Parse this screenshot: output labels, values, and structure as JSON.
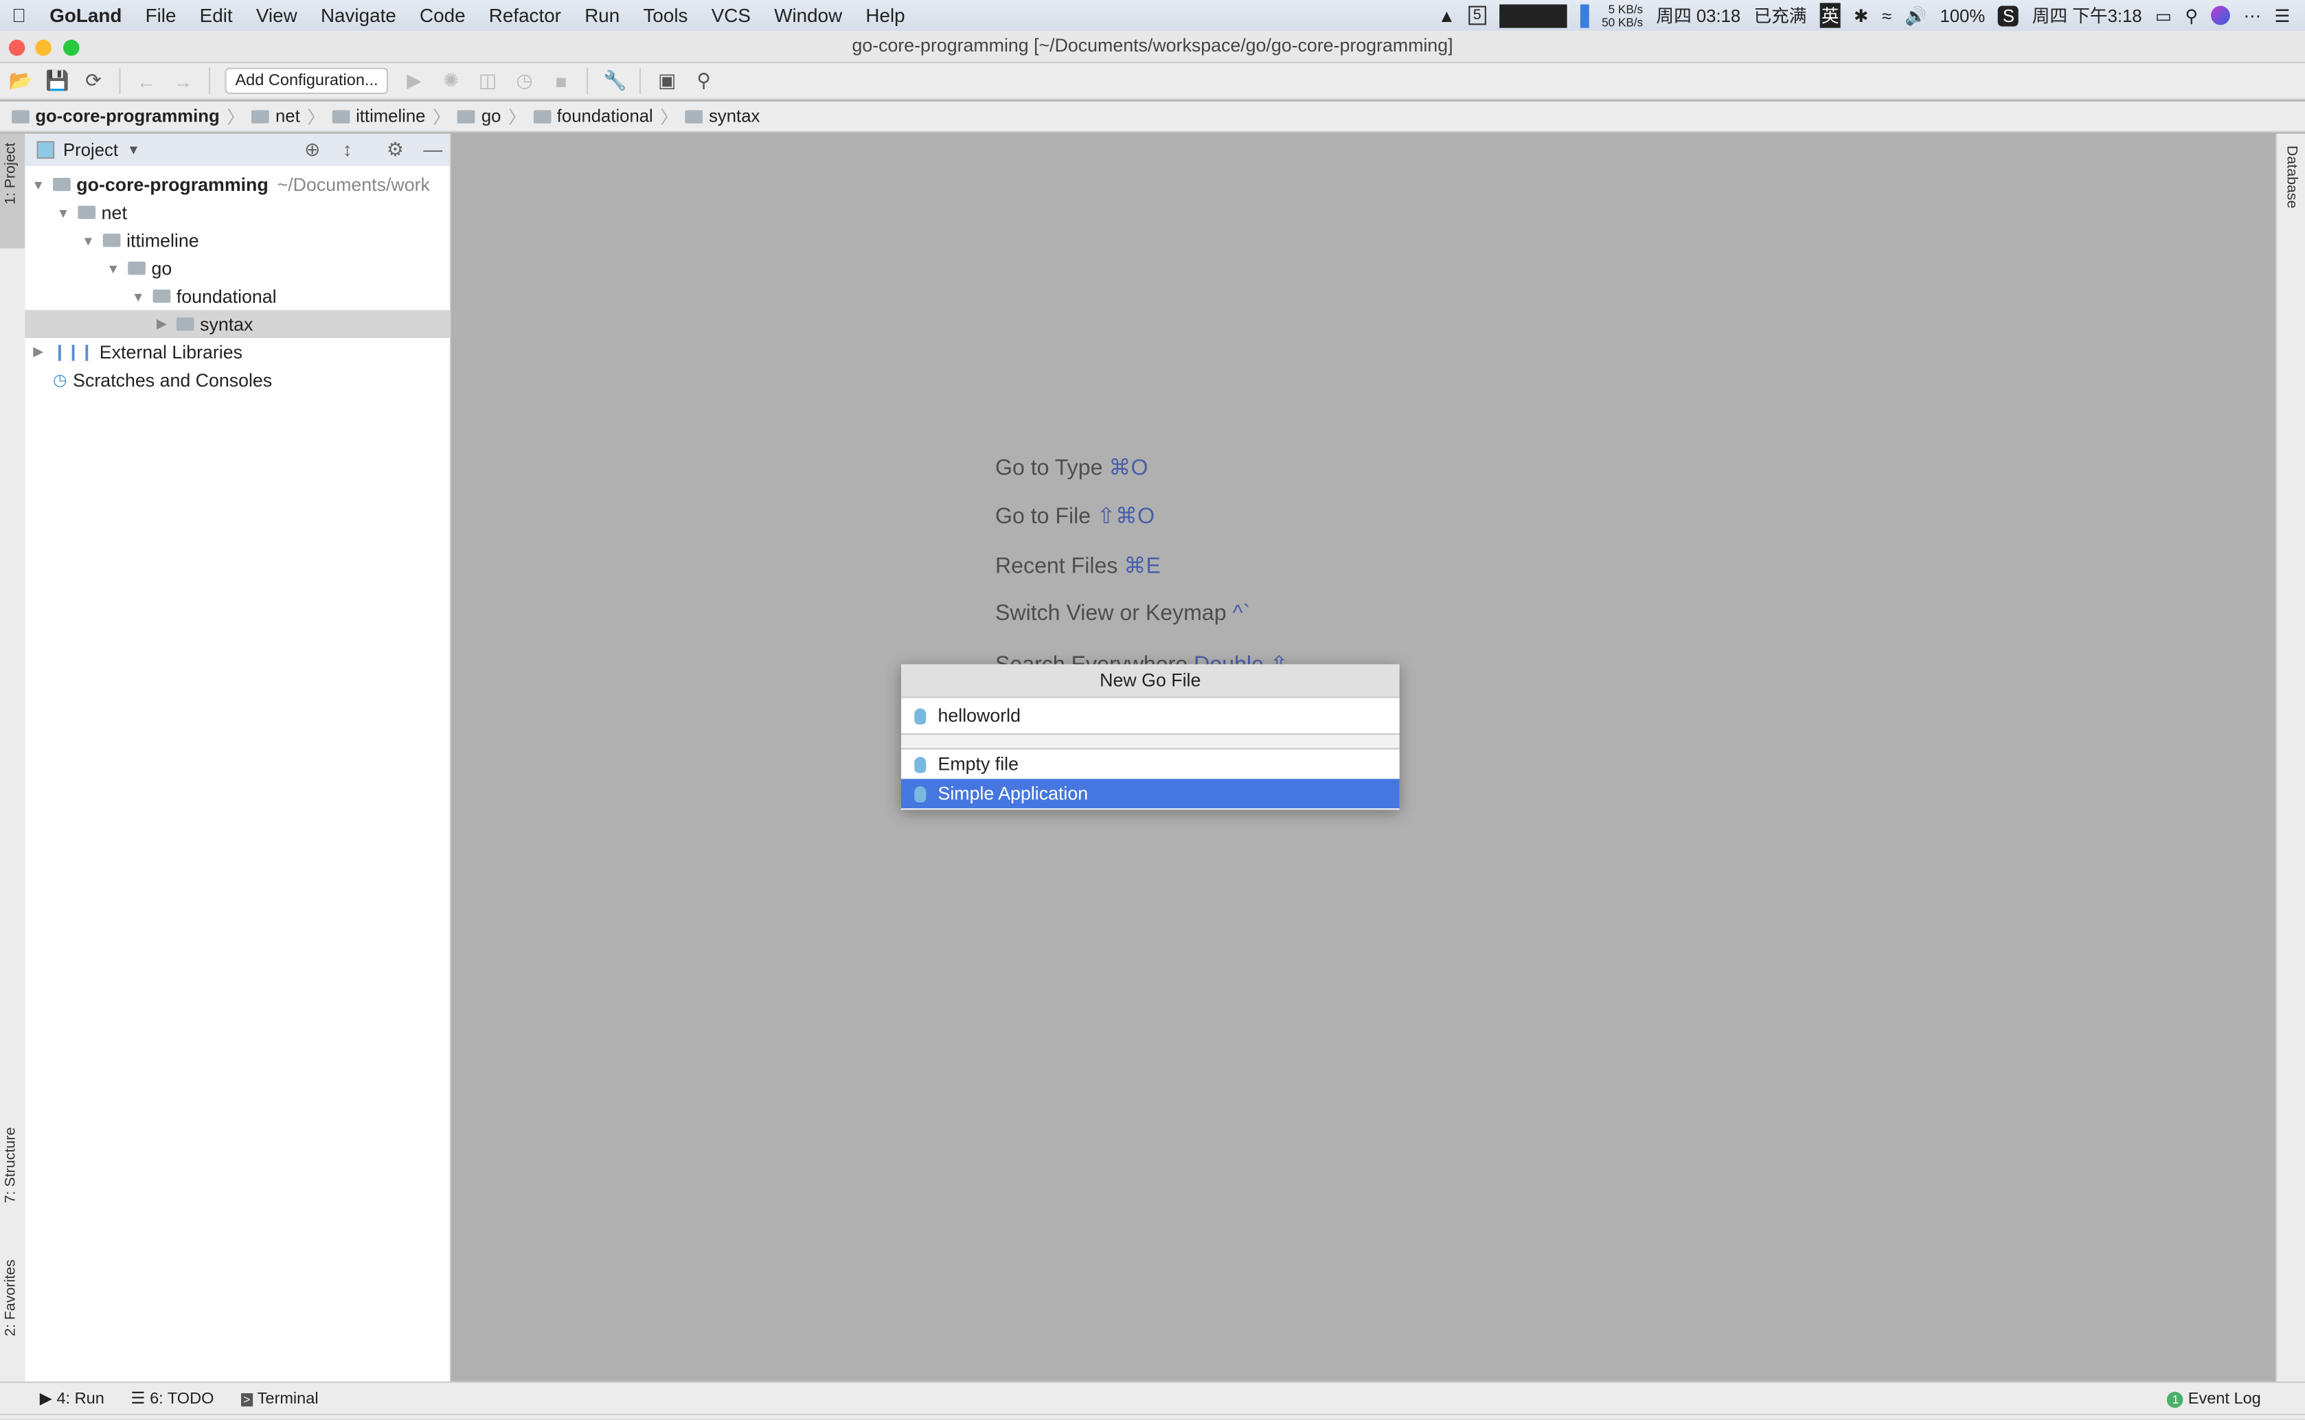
{
  "menubar": {
    "app": "GoLand",
    "items": [
      "File",
      "Edit",
      "View",
      "Navigate",
      "Code",
      "Refactor",
      "Run",
      "Tools",
      "VCS",
      "Window",
      "Help"
    ],
    "tray": {
      "net_up": "5 KB/s",
      "net_down": "50 KB/s",
      "clock1": "周四 03:18",
      "charge": "已充满",
      "input": "英",
      "battery": "100%",
      "clock2": "周四 下午3:18",
      "calendar_day": "5"
    }
  },
  "window": {
    "title": "go-core-programming [~/Documents/workspace/go/go-core-programming]"
  },
  "toolbar": {
    "add_config": "Add Configuration..."
  },
  "breadcrumb": [
    "go-core-programming",
    "net",
    "ittimeline",
    "go",
    "foundational",
    "syntax"
  ],
  "sidebar": {
    "project_tab": "1: Project",
    "structure_tab": "7: Structure",
    "favorites_tab": "2: Favorites"
  },
  "project": {
    "title": "Project",
    "tree": [
      {
        "label": "go-core-programming",
        "hint": "~/Documents/work",
        "level": 0,
        "expanded": true
      },
      {
        "label": "net",
        "level": 1,
        "expanded": true
      },
      {
        "label": "ittimeline",
        "level": 2,
        "expanded": true
      },
      {
        "label": "go",
        "level": 3,
        "expanded": true
      },
      {
        "label": "foundational",
        "level": 4,
        "expanded": true
      },
      {
        "label": "syntax",
        "level": 5,
        "expanded": false,
        "selected": true
      },
      {
        "label": "External Libraries",
        "level": 0,
        "expanded": false
      },
      {
        "label": "Scratches and Consoles",
        "level": 0
      }
    ]
  },
  "editor": {
    "hints": [
      {
        "label": "Go to Type",
        "key": "⌘O"
      },
      {
        "label": "Go to File",
        "key": "⇧⌘O"
      },
      {
        "label": "Recent Files",
        "key": "⌘E"
      },
      {
        "label": "Switch View or Keymap",
        "key": "^`"
      },
      {
        "label": "Search Everywhere",
        "key": "Double ⇧"
      }
    ]
  },
  "right_stripe": {
    "database": "Database"
  },
  "dialog": {
    "title": "New Go File",
    "name_value": "helloworld",
    "options": [
      "Empty file",
      "Simple Application"
    ],
    "selected": "Simple Application"
  },
  "bottombar": {
    "run": "4: Run",
    "todo": "6: TODO",
    "terminal": "Terminal",
    "event_log": "Event Log",
    "event_count": "1"
  },
  "colors": {
    "selection": "#4677e0",
    "shortcut": "#4a5fa8",
    "editor_bg": "#b0b0b0"
  }
}
